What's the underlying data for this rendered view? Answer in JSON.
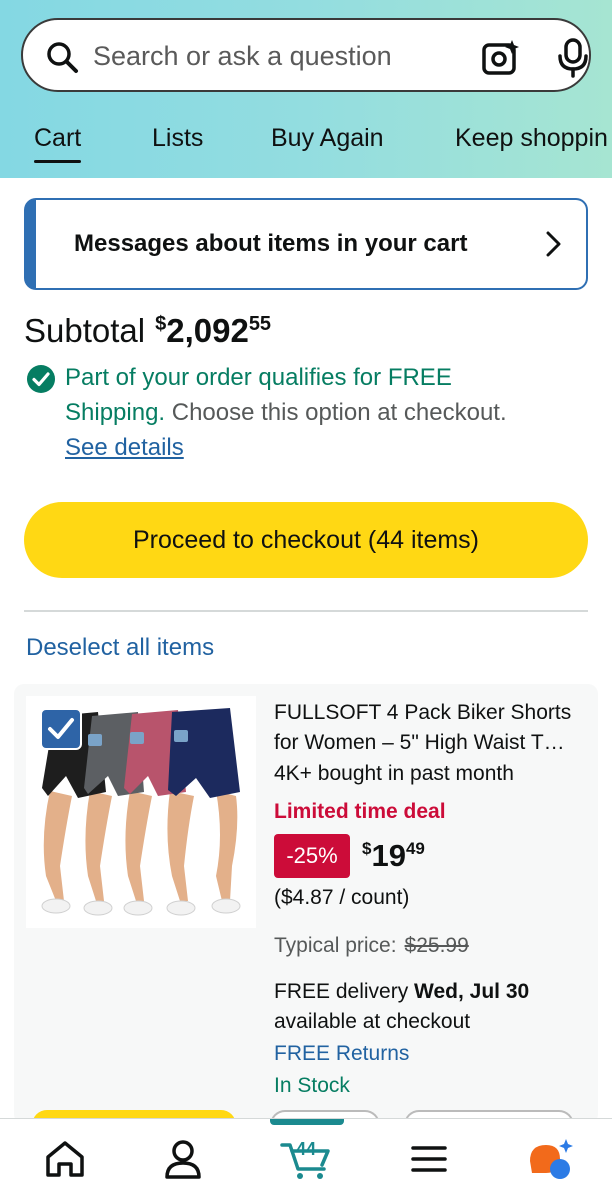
{
  "search": {
    "placeholder": "Search or ask a question"
  },
  "tabs": [
    {
      "label": "Cart",
      "active": true
    },
    {
      "label": "Lists"
    },
    {
      "label": "Buy Again"
    },
    {
      "label": "Keep shoppin"
    }
  ],
  "messages": {
    "label": "Messages about items in your cart"
  },
  "subtotal": {
    "label": "Subtotal",
    "currency": "$",
    "whole": "2,092",
    "fraction": "55"
  },
  "free_shipping": {
    "line1": "Part of your order qualifies for FREE",
    "line2_green": "Shipping.",
    "line2_grey": " Choose this option at checkout.",
    "details_link": "See details"
  },
  "checkout_button": "Proceed to checkout (44 items)",
  "deselect": "Deselect all items",
  "item": {
    "title_line1": "FULLSOFT 4 Pack Biker Shorts",
    "title_line2": "for Women – 5\" High Waist T…",
    "bought": "4K+ bought in past month",
    "deal": "Limited time deal",
    "discount": "-25%",
    "price_currency": "$",
    "price_whole": "19",
    "price_fraction": "49",
    "unit_price": "($4.87 / count)",
    "typical_label": "Typical price:",
    "typical_price": "$25.99",
    "delivery_prefix": "FREE delivery ",
    "delivery_date": "Wed, Jul 30",
    "availability": "available at checkout",
    "returns": "FREE Returns",
    "stock": "In Stock",
    "selected": true
  },
  "bottom_nav": {
    "cart_count": "44",
    "items": [
      "home-icon",
      "account-icon",
      "cart-icon",
      "menu-icon",
      "rufus-ai-icon"
    ]
  },
  "colors": {
    "accent_yellow": "#ffd814",
    "link_blue": "#2162a1",
    "green": "#067d62",
    "deal_red": "#cc0c39",
    "cart_teal": "#1b8a8f"
  }
}
